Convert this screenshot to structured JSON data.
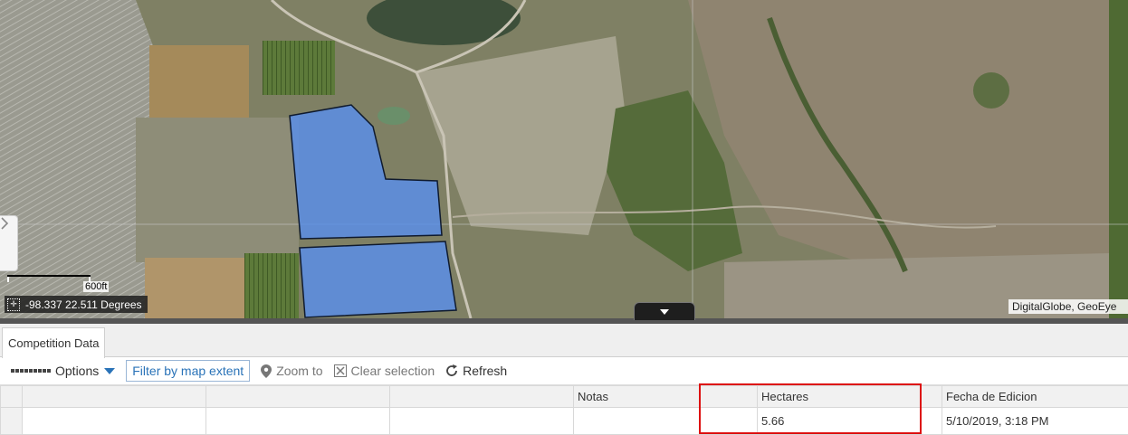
{
  "map": {
    "scale_label": "600ft",
    "coordinates": "-98.337 22.511 Degrees",
    "attribution": "DigitalGlobe, GeoEye",
    "colors": {
      "parcel_fill": "#5b8ee6",
      "parcel_stroke": "#0f1a2e"
    }
  },
  "panel": {
    "tab_label": "Competition Data",
    "toolbar": {
      "options_label": "Options",
      "filter_label": "Filter by map extent",
      "zoom_label": "Zoom to",
      "clear_label": "Clear selection",
      "refresh_label": "Refresh"
    },
    "table": {
      "columns": [
        "",
        "",
        "",
        "Notas",
        "",
        "Hectares",
        "Fecha de Edicion"
      ],
      "rows": [
        [
          "",
          "",
          "",
          "",
          "",
          "5.66",
          "5/10/2019, 3:18 PM"
        ]
      ]
    },
    "highlight_color": "#dd1111"
  }
}
